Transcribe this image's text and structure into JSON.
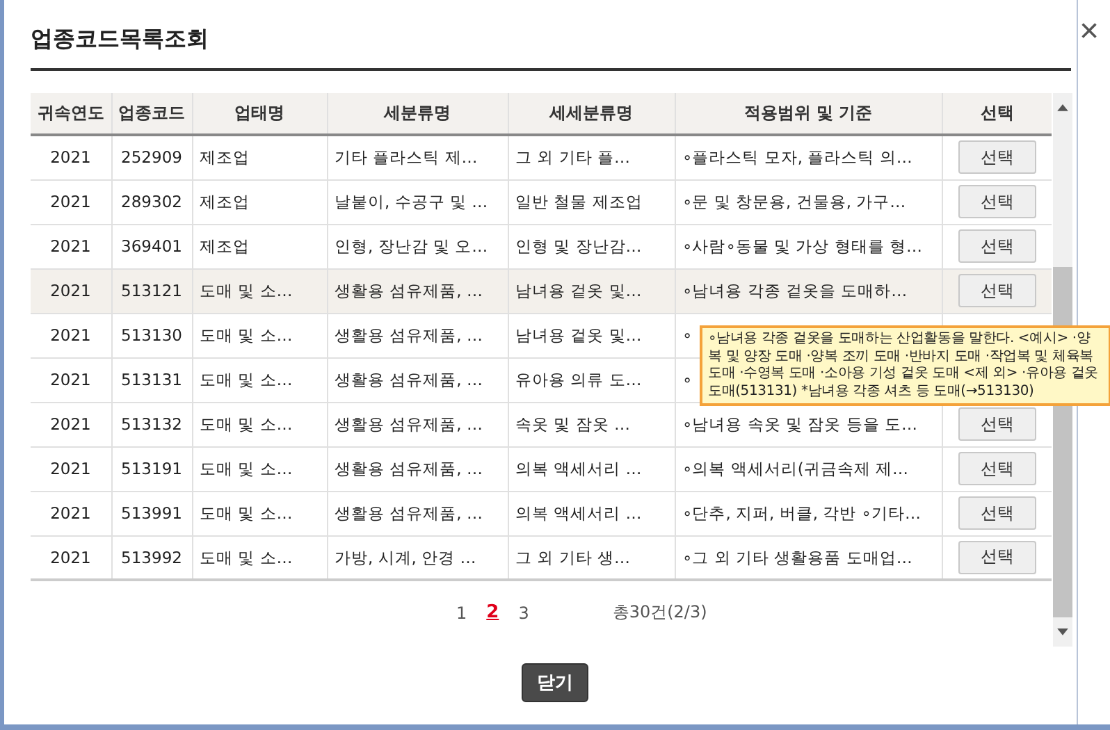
{
  "dialog": {
    "title": "업종코드목록조회",
    "close": "×"
  },
  "table": {
    "columns": [
      "귀속연도",
      "업종코드",
      "업태명",
      "세분류명",
      "세세분류명",
      "적용범위 및 기준",
      "선택"
    ],
    "rows": [
      {
        "year": "2021",
        "code": "252909",
        "business": "제조업",
        "sub": "기타 플라스틱 제…",
        "subsub": "그 외 기타 플…",
        "scope": "∘플라스틱 모자, 플라스틱 의…",
        "select": "선택",
        "hovered": false
      },
      {
        "year": "2021",
        "code": "289302",
        "business": "제조업",
        "sub": "날붙이, 수공구 및 …",
        "subsub": "일반 철물 제조업",
        "scope": "∘문 및 창문용, 건물용, 가구…",
        "select": "선택",
        "hovered": false
      },
      {
        "year": "2021",
        "code": "369401",
        "business": "제조업",
        "sub": "인형, 장난감 및 오…",
        "subsub": "인형 및 장난감…",
        "scope": "∘사람∘동물 및 가상 형태를 형…",
        "select": "선택",
        "hovered": false
      },
      {
        "year": "2021",
        "code": "513121",
        "business": "도매 및 소…",
        "sub": "생활용 섬유제품, …",
        "subsub": "남녀용 겉옷 및…",
        "scope": "∘남녀용 각종 겉옷을 도매하…",
        "select": "선택",
        "hovered": true
      },
      {
        "year": "2021",
        "code": "513130",
        "business": "도매 및 소…",
        "sub": "생활용 섬유제품, …",
        "subsub": "남녀용 겉옷 및…",
        "scope": "∘",
        "hovered": false
      },
      {
        "year": "2021",
        "code": "513131",
        "business": "도매 및 소…",
        "sub": "생활용 섬유제품, …",
        "subsub": "유아용 의류 도…",
        "scope": "∘",
        "hovered": false
      },
      {
        "year": "2021",
        "code": "513132",
        "business": "도매 및 소…",
        "sub": "생활용 섬유제품, …",
        "subsub": "속옷 및 잠옷 …",
        "scope": "∘남녀용 속옷 및 잠옷 등을 도…",
        "select": "선택",
        "hovered": false
      },
      {
        "year": "2021",
        "code": "513191",
        "business": "도매 및 소…",
        "sub": "생활용 섬유제품, …",
        "subsub": "의복 액세서리 …",
        "scope": "∘의복 액세서리(귀금속제 제…",
        "select": "선택",
        "hovered": false
      },
      {
        "year": "2021",
        "code": "513991",
        "business": "도매 및 소…",
        "sub": "생활용 섬유제품, …",
        "subsub": "의복 액세서리 …",
        "scope": "∘단추, 지퍼, 버클, 각반 ∘기타…",
        "select": "선택",
        "hovered": false
      },
      {
        "year": "2021",
        "code": "513992",
        "business": "도매 및 소…",
        "sub": "가방, 시계, 안경 …",
        "subsub": "그 외 기타 생…",
        "scope": "∘그 외 기타 생활용품 도매업…",
        "select": "선택",
        "hovered": false
      }
    ]
  },
  "tooltip": "∘남녀용 각종 겉옷을 도매하는 산업활동을 말한다. <예시> ·양복 및 양장 도매 ·양복 조끼 도매 ·반바지 도매 ·작업복 및 체육복 도매 ·수영복 도매 ·소아용 기성 겉옷 도매 <제 외> ·유아용 겉옷 도매(513131) *남녀용 각종 셔츠 등 도매(→513130)",
  "pagination": {
    "pages": [
      {
        "label": "1",
        "selected": false
      },
      {
        "label": "2",
        "selected": true
      },
      {
        "label": "3",
        "selected": false
      }
    ],
    "summary": "총30건(2/3)"
  },
  "close_button": "닫기"
}
